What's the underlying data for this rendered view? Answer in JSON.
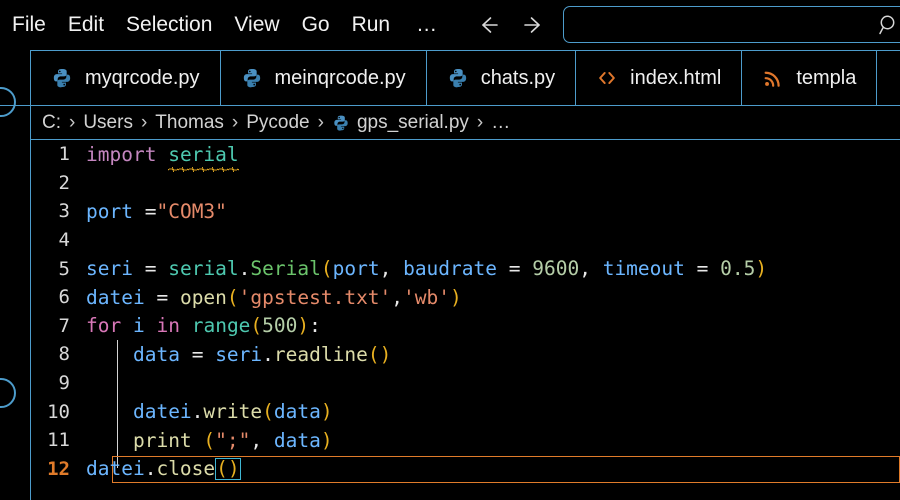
{
  "window": {
    "menu": [
      {
        "label": "File",
        "name": "menu-file"
      },
      {
        "label": "Edit",
        "name": "menu-edit"
      },
      {
        "label": "Selection",
        "name": "menu-selection"
      },
      {
        "label": "View",
        "name": "menu-view"
      },
      {
        "label": "Go",
        "name": "menu-go"
      },
      {
        "label": "Run",
        "name": "menu-run"
      }
    ],
    "overflow_label": "…",
    "back_icon": "arrow-left-icon",
    "forward_icon": "arrow-right-icon"
  },
  "search": {
    "value": "",
    "placeholder": "",
    "icon": "search-icon",
    "border_color": "#4d9ccb"
  },
  "tabs": [
    {
      "label": "myqrcode.py",
      "icon": "python-icon",
      "icon_color": "#4a90c2",
      "active": false
    },
    {
      "label": "meinqrcode.py",
      "icon": "python-icon",
      "icon_color": "#4a90c2",
      "active": false
    },
    {
      "label": "chats.py",
      "icon": "python-icon",
      "icon_color": "#4a90c2",
      "active": false
    },
    {
      "label": "index.html",
      "icon": "code-brackets-icon",
      "icon_color": "#e0772c",
      "active": false
    },
    {
      "label": "templa",
      "icon": "rss-icon",
      "icon_color": "#e0772c",
      "active": false
    }
  ],
  "breadcrumb": {
    "segments": [
      "C:",
      "Users",
      "Thomas",
      "Pycode",
      "gps_serial.py",
      "…"
    ],
    "separator": "›",
    "file_icon": "python-icon"
  },
  "editor": {
    "active_line": 12,
    "active_line_color": "#e07b2a",
    "bracket_match_color": "#3fb6d3",
    "error_squiggle_color": "#d9a021",
    "lines": [
      {
        "n": "1",
        "text": "import serial"
      },
      {
        "n": "2",
        "text": ""
      },
      {
        "n": "3",
        "text": "port =\"COM3\""
      },
      {
        "n": "4",
        "text": ""
      },
      {
        "n": "5",
        "text": "seri = serial.Serial(port, baudrate = 9600, timeout = 0.5)"
      },
      {
        "n": "6",
        "text": "datei = open('gpstest.txt','wb')"
      },
      {
        "n": "7",
        "text": "for i in range(500):"
      },
      {
        "n": "8",
        "text": "    data = seri.readline()"
      },
      {
        "n": "9",
        "text": ""
      },
      {
        "n": "10",
        "text": "    datei.write(data)"
      },
      {
        "n": "11",
        "text": "    print (\";\", data)"
      },
      {
        "n": "12",
        "text": "datei.close()"
      }
    ],
    "tokens": {
      "import_kw": "import",
      "module_serial": "serial",
      "var_port": "port",
      "op_eq": "=",
      "str_com3": "\"COM3\"",
      "var_seri": "seri",
      "cls_Serial": "Serial",
      "kw_baudrate": "baudrate",
      "num_9600": "9600",
      "kw_timeout": "timeout",
      "num_05": "0.5",
      "var_datei": "datei",
      "fn_open": "open",
      "str_gpstest": "'gpstest.txt'",
      "str_wb": "'wb'",
      "kw_for": "for",
      "var_i": "i",
      "kw_in": "in",
      "fn_range": "range",
      "num_500": "500",
      "var_data": "data",
      "fn_readline": "readline",
      "fn_write": "write",
      "fn_print": "print",
      "str_semi": "\";\"",
      "fn_close": "close"
    }
  }
}
